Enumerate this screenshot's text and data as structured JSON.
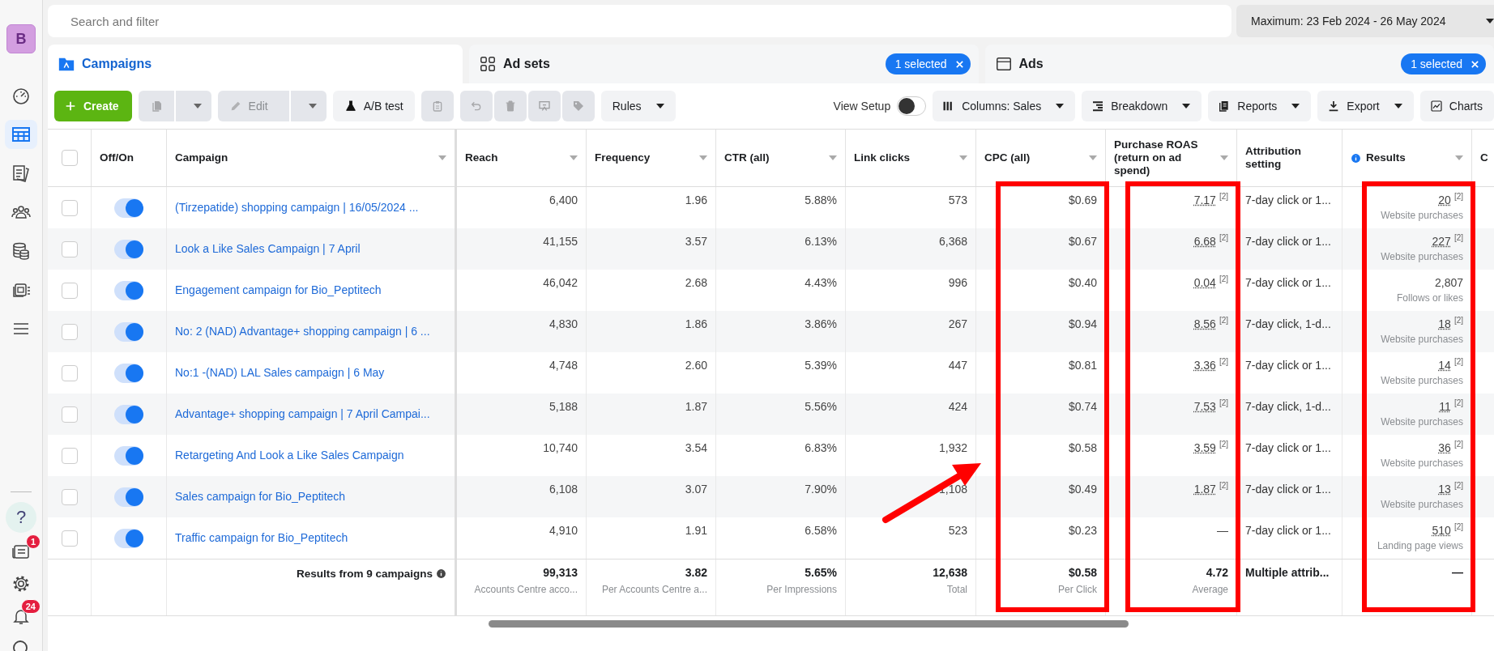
{
  "sidebar": {
    "avatar": "B",
    "items": [
      {
        "selected": false
      },
      {
        "selected": true
      },
      {
        "selected": false
      },
      {
        "selected": false
      },
      {
        "selected": false
      },
      {
        "selected": false
      },
      {
        "selected": false
      }
    ],
    "bottom_items": [
      {
        "kind": "help",
        "glyph": "?"
      },
      {
        "kind": "news",
        "badge": "1"
      },
      {
        "kind": "settings"
      },
      {
        "kind": "notifications",
        "badge": "24"
      },
      {
        "kind": "search"
      }
    ]
  },
  "search": {
    "placeholder": "Search and filter"
  },
  "date_range": "Maximum: 23 Feb 2024 - 26 May 2024",
  "tabs": [
    {
      "label": "Campaigns",
      "selected": true
    },
    {
      "label": "Ad sets",
      "selected": false,
      "badge": "1 selected"
    },
    {
      "label": "Ads",
      "selected": false,
      "badge": "1 selected"
    }
  ],
  "toolbar": {
    "left": [
      {
        "kind": "primary",
        "label": "Create",
        "disabled": false
      },
      {
        "kind": "split",
        "disabled": true
      },
      {
        "kind": "split",
        "label": "Edit",
        "disabled": true
      },
      {
        "kind": "button",
        "label": "A/B test",
        "disabled": false
      },
      {
        "kind": "icon",
        "disabled": true
      },
      {
        "kind": "icon",
        "disabled": true
      },
      {
        "kind": "grouped",
        "disabled": true
      },
      {
        "kind": "grouped",
        "disabled": true
      },
      {
        "kind": "grouped",
        "disabled": true
      },
      {
        "kind": "dropdown",
        "label": "Rules",
        "disabled": false
      }
    ],
    "view_setup": {
      "label": "View Setup",
      "on": false
    },
    "right": [
      {
        "kind": "dropdown",
        "label": "Columns: Sales"
      },
      {
        "kind": "dropdown",
        "label": "Breakdown"
      },
      {
        "kind": "dropdown",
        "label": "Reports"
      },
      {
        "kind": "dropdown",
        "label": "Export"
      },
      {
        "kind": "button",
        "label": "Charts"
      }
    ]
  },
  "table": {
    "all_selected": false,
    "columns": [
      {
        "label": "Off/On",
        "sortable": false,
        "highlighted": false
      },
      {
        "label": "Campaign",
        "sortable": true,
        "highlighted": false
      },
      {
        "label": "Reach",
        "sortable": true,
        "highlighted": false
      },
      {
        "label": "Frequency",
        "sortable": true,
        "highlighted": false
      },
      {
        "label": "CTR (all)",
        "sortable": true,
        "highlighted": false
      },
      {
        "label": "Link clicks",
        "sortable": true,
        "highlighted": false
      },
      {
        "label": "CPC (all)",
        "sortable": true,
        "highlighted": true
      },
      {
        "label": "Purchase ROAS (return on ad spend)",
        "sortable": true,
        "highlighted": true
      },
      {
        "label": "Attribution setting",
        "sortable": false,
        "highlighted": false
      },
      {
        "label": "Results",
        "sortable": true,
        "highlighted": true,
        "info": true
      },
      {
        "label": "C"
      }
    ],
    "rows": [
      {
        "selected": false,
        "on": true,
        "campaign": "(Tirzepatide) shopping campaign | 16/05/2024 ...",
        "metrics": [
          "6,400",
          "1.96",
          "5.88%",
          "573",
          "$0.69"
        ],
        "roas": {
          "value": "7.17",
          "ref": "[2]"
        },
        "attribution": "7-day click or 1...",
        "result": {
          "value": "20",
          "ref": "[2]",
          "type": "Website purchases"
        }
      },
      {
        "selected": false,
        "on": true,
        "campaign": "Look a Like Sales Campaign | 7 April",
        "metrics": [
          "41,155",
          "3.57",
          "6.13%",
          "6,368",
          "$0.67"
        ],
        "roas": {
          "value": "6.68",
          "ref": "[2]"
        },
        "attribution": "7-day click or 1...",
        "result": {
          "value": "227",
          "ref": "[2]",
          "type": "Website purchases"
        }
      },
      {
        "selected": false,
        "on": true,
        "campaign": "Engagement campaign for Bio_Peptitech",
        "metrics": [
          "46,042",
          "2.68",
          "4.43%",
          "996",
          "$0.40"
        ],
        "roas": {
          "value": "0.04",
          "ref": "[2]"
        },
        "attribution": "7-day click or 1...",
        "result": {
          "value": "2,807",
          "type": "Follows or likes"
        }
      },
      {
        "selected": false,
        "on": true,
        "campaign": "No: 2 (NAD) Advantage+ shopping campaign | 6 ...",
        "metrics": [
          "4,830",
          "1.86",
          "3.86%",
          "267",
          "$0.94"
        ],
        "roas": {
          "value": "8.56",
          "ref": "[2]"
        },
        "attribution": "7-day click, 1-d...",
        "result": {
          "value": "18",
          "ref": "[2]",
          "type": "Website purchases"
        }
      },
      {
        "selected": false,
        "on": true,
        "campaign": "No:1 -(NAD) LAL Sales campaign | 6 May",
        "metrics": [
          "4,748",
          "2.60",
          "5.39%",
          "447",
          "$0.81"
        ],
        "roas": {
          "value": "3.36",
          "ref": "[2]"
        },
        "attribution": "7-day click or 1...",
        "result": {
          "value": "14",
          "ref": "[2]",
          "type": "Website purchases"
        }
      },
      {
        "selected": false,
        "on": true,
        "campaign": "Advantage+ shopping campaign | 7 April Campai...",
        "metrics": [
          "5,188",
          "1.87",
          "5.56%",
          "424",
          "$0.74"
        ],
        "roas": {
          "value": "7.53",
          "ref": "[2]"
        },
        "attribution": "7-day click, 1-d...",
        "result": {
          "value": "11",
          "ref": "[2]",
          "type": "Website purchases"
        }
      },
      {
        "selected": false,
        "on": true,
        "campaign": "Retargeting And Look a Like Sales Campaign",
        "metrics": [
          "10,740",
          "3.54",
          "6.83%",
          "1,932",
          "$0.58"
        ],
        "roas": {
          "value": "3.59",
          "ref": "[2]"
        },
        "attribution": "7-day click or 1...",
        "result": {
          "value": "36",
          "ref": "[2]",
          "type": "Website purchases"
        }
      },
      {
        "selected": false,
        "on": true,
        "campaign": "Sales campaign for Bio_Peptitech",
        "metrics": [
          "6,108",
          "3.07",
          "7.90%",
          "1,108",
          "$0.49"
        ],
        "roas": {
          "value": "1.87",
          "ref": "[2]"
        },
        "attribution": "7-day click or 1...",
        "result": {
          "value": "13",
          "ref": "[2]",
          "type": "Website purchases"
        }
      },
      {
        "selected": false,
        "on": true,
        "campaign": "Traffic campaign for Bio_Peptitech",
        "metrics": [
          "4,910",
          "1.91",
          "6.58%",
          "523",
          "$0.23"
        ],
        "roas": {
          "value": "—"
        },
        "attribution": "7-day click or 1...",
        "result": {
          "value": "510",
          "ref": "[2]",
          "type": "Landing page views"
        }
      }
    ],
    "summary": {
      "label": "Results from 9 campaigns",
      "cells": [
        {
          "value": "99,313",
          "note": "Accounts Centre acco..."
        },
        {
          "value": "3.82",
          "note": "Per Accounts Centre a..."
        },
        {
          "value": "5.65%",
          "note": "Per Impressions"
        },
        {
          "value": "12,638",
          "note": "Total"
        },
        {
          "value": "$0.58",
          "note": "Per Click"
        },
        {
          "value": "4.72",
          "note": "Average"
        },
        {
          "value": "Multiple attrib..."
        },
        {
          "value": "—"
        }
      ]
    }
  },
  "annotation_arrow": true
}
